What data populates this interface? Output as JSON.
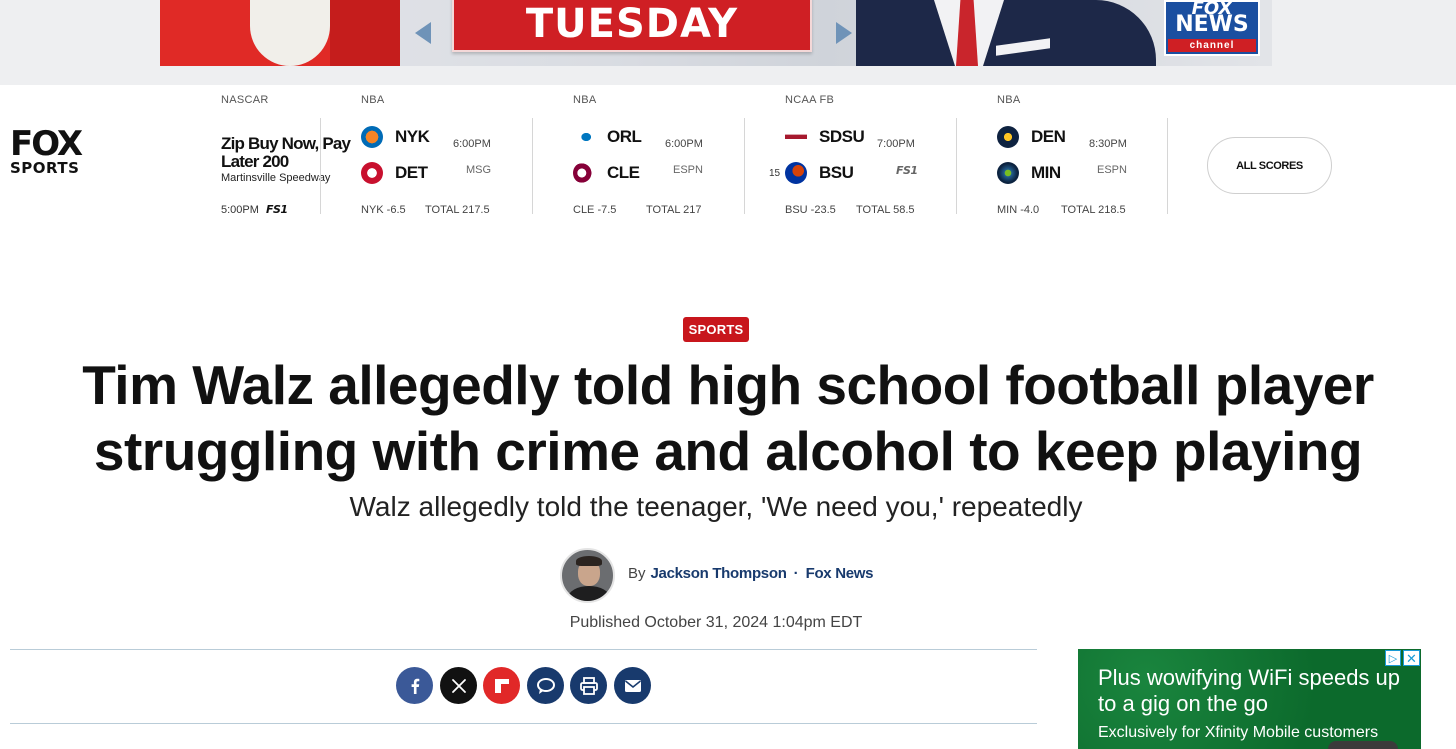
{
  "banner": {
    "day_label": "TUESDAY",
    "channel_logo_top": "FOX",
    "channel_logo_mid": "NEWS",
    "channel_logo_bottom": "channel"
  },
  "brand": {
    "fox": "FOX",
    "sports": "SPORTS"
  },
  "scores": {
    "race": {
      "league": "NASCAR",
      "name": "Zip Buy Now, Pay Later 200",
      "track": "Martinsville Speedway",
      "time": "5:00PM",
      "network": "FS1"
    },
    "games": [
      {
        "league": "NBA",
        "team1": "NYK",
        "team2": "DET",
        "time": "6:00PM",
        "network": "MSG",
        "spread": "NYK -6.5",
        "total": "TOTAL 217.5",
        "team1_color": "#f58426",
        "team2_color": "#c8102e"
      },
      {
        "league": "NBA",
        "team1": "ORL",
        "team2": "CLE",
        "time": "6:00PM",
        "network": "ESPN",
        "spread": "CLE -7.5",
        "total": "TOTAL 217",
        "team1_color": "#0077c0",
        "team2_color": "#860038"
      },
      {
        "league": "NCAA FB",
        "team1": "SDSU",
        "team2": "BSU",
        "team2_seed": "15",
        "time": "7:00PM",
        "network": "FS1",
        "spread": "BSU -23.5",
        "total": "TOTAL 58.5",
        "team1_color": "#a6192e",
        "team2_color": "#0033a0"
      },
      {
        "league": "NBA",
        "team1": "DEN",
        "team2": "MIN",
        "time": "8:30PM",
        "network": "ESPN",
        "spread": "MIN -4.0",
        "total": "TOTAL 218.5",
        "team1_color": "#0e2240",
        "team2_color": "#0c2340"
      }
    ],
    "all_scores_label": "ALL SCORES"
  },
  "article": {
    "category": "SPORTS",
    "headline_line1": "Tim Walz allegedly told high school football player",
    "headline_line2": "struggling with crime and alcohol to keep playing",
    "subhead": "Walz allegedly told the teenager, 'We need you,' repeatedly",
    "by_prefix": "By",
    "author": "Jackson Thompson",
    "separator": "·",
    "source": "Fox News",
    "published": "Published October 31, 2024 1:04pm EDT"
  },
  "share": [
    {
      "name": "facebook",
      "icon": "facebook-icon",
      "color": "#3b5998"
    },
    {
      "name": "x",
      "icon": "x-icon",
      "color": "#111111"
    },
    {
      "name": "flipboard",
      "icon": "flipboard-icon",
      "color": "#e12828"
    },
    {
      "name": "comments",
      "icon": "comment-icon",
      "color": "#183a6d"
    },
    {
      "name": "print",
      "icon": "print-icon",
      "color": "#183a6d"
    },
    {
      "name": "email",
      "icon": "email-icon",
      "color": "#183a6d"
    }
  ],
  "ad": {
    "headline": "Plus wowifying WiFi speeds up to a gig on the go",
    "sub": "Exclusively for Xfinity Mobile customers",
    "adchoices_glyph": "▷",
    "close_glyph": "✕",
    "background": "#0c6a2c"
  }
}
